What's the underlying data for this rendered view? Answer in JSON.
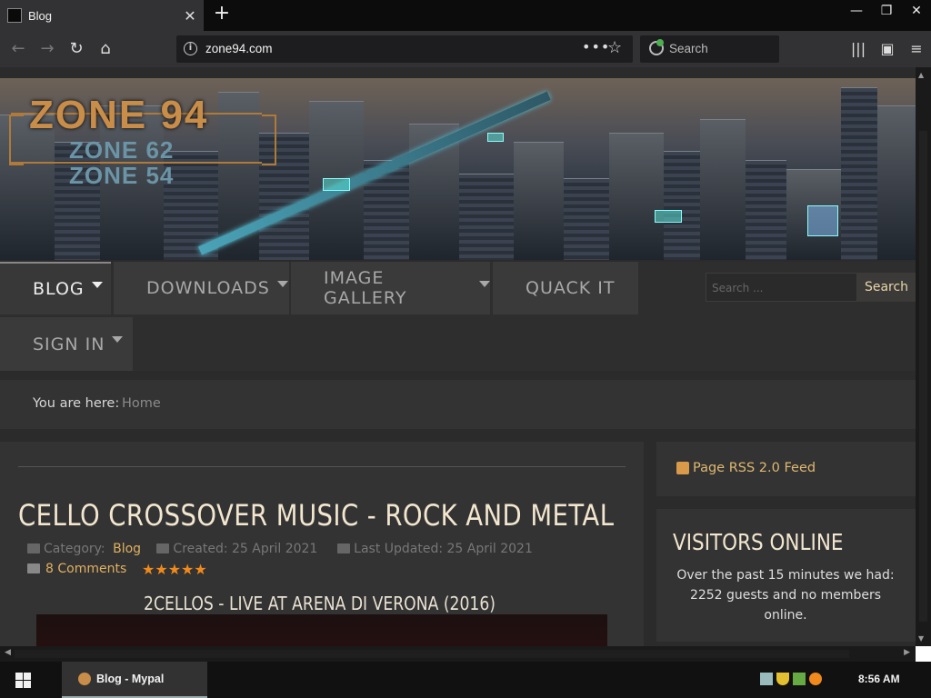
{
  "browser": {
    "tab_title": "Blog",
    "url": "zone94.com",
    "search_placeholder": "Search"
  },
  "site": {
    "logo_main": "ZONE 94",
    "logo_sub1": "ZONE 62",
    "logo_sub2": "ZONE 54"
  },
  "menu": {
    "items": [
      {
        "label": "BLOG"
      },
      {
        "label": "DOWNLOADS"
      },
      {
        "label": "IMAGE GALLERY"
      },
      {
        "label": "QUACK IT"
      },
      {
        "label": "SIGN IN"
      }
    ],
    "search_placeholder": "Search ...",
    "search_button": "Search"
  },
  "breadcrumb": {
    "label": "You are here:",
    "home": "Home"
  },
  "article": {
    "title": "CELLO CROSSOVER MUSIC - ROCK AND METAL",
    "category_label": "Category:",
    "category": "Blog",
    "created": "Created: 25 April 2021",
    "updated": "Last Updated: 25 April 2021",
    "comments": "8 Comments",
    "rating_stars": 5,
    "subtitle": "2CELLOS - LIVE AT ARENA DI VERONA (2016)"
  },
  "sidebar": {
    "rss": "Page RSS 2.0 Feed",
    "visitors_title": "VISITORS ONLINE",
    "visitors_text": "Over the past 15 minutes we had: 2252 guests and no members online."
  },
  "taskbar": {
    "app_label": "Blog - Mypal",
    "time": "8:56 AM"
  },
  "colors": {
    "accent": "#e0b060",
    "title": "#f2e6cf",
    "stars": "#f08a1c"
  }
}
